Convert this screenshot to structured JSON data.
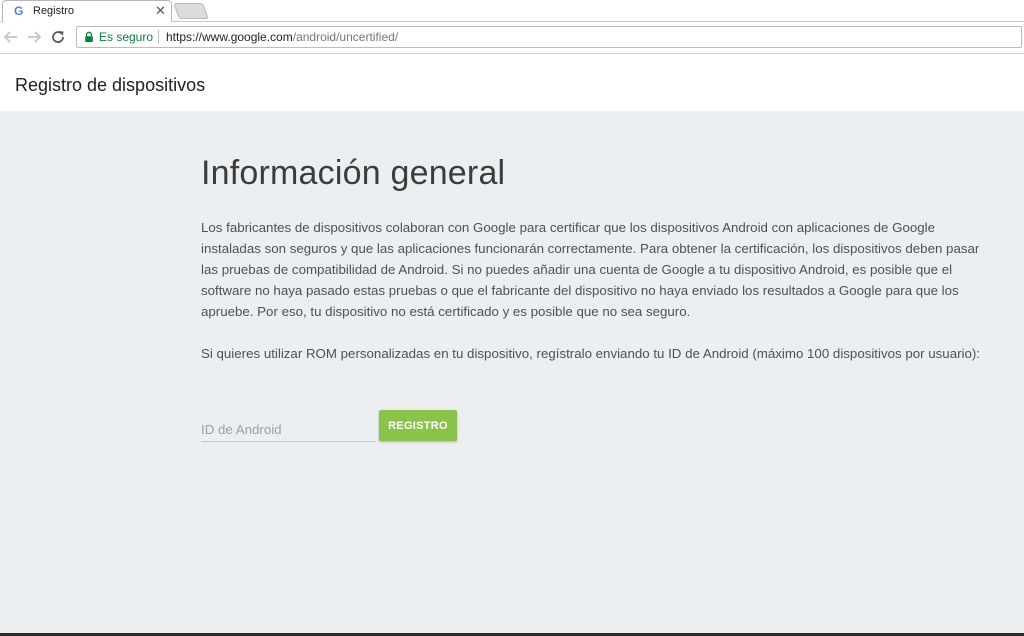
{
  "browser": {
    "tab": {
      "favicon": "G",
      "title": "Registro",
      "close": "✕"
    },
    "omnibox": {
      "secure_label": "Es seguro",
      "url_host": "https://www.google.com",
      "url_path": "/android/uncertified/"
    },
    "icons": {
      "back": "arrow-left-icon",
      "forward": "arrow-right-icon",
      "reload": "reload-icon",
      "lock": "lock-icon"
    },
    "colors": {
      "secure": "#0b8043",
      "accent_button": "#8bc34a",
      "page_background": "#eceff1"
    }
  },
  "header": {
    "title": "Registro de dispositivos"
  },
  "main": {
    "heading": "Información general",
    "paragraph1": "Los fabricantes de dispositivos colaboran con Google para certificar que los dispositivos Android con aplicaciones de Google instaladas son seguros y que las aplicaciones funcionarán correctamente. Para obtener la certificación, los dispositivos deben pasar las pruebas de compatibilidad de Android. Si no puedes añadir una cuenta de Google a tu dispositivo Android, es posible que el software no haya pasado estas pruebas o que el fabricante del dispositivo no haya enviado los resultados a Google para que los apruebe. Por eso, tu dispositivo no está certificado y es posible que no sea seguro.",
    "paragraph2": "Si quieres utilizar ROM personalizadas en tu dispositivo, regístralo enviando tu ID de Android (máximo 100 dispositivos por usuario):",
    "input_placeholder": "ID de Android",
    "input_value": "",
    "button_label": "REGISTRO"
  }
}
